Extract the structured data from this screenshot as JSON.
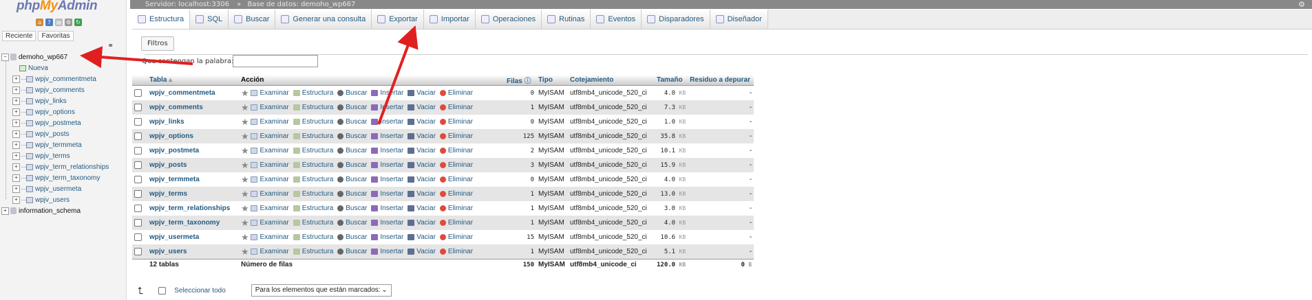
{
  "app": {
    "logo_php": "php",
    "logo_my": "My",
    "logo_admin": "Admin",
    "nav_tab_recent": "Reciente",
    "nav_tab_favorites": "Favoritas"
  },
  "breadcrumb": {
    "server": "Servidor: localhost:3306",
    "database": "Base de datos: demoho_wp667"
  },
  "tree": {
    "db_name": "demoho_wp667",
    "new_label": "Nueva",
    "tables": [
      "wpjv_commentmeta",
      "wpjv_comments",
      "wpjv_links",
      "wpjv_options",
      "wpjv_postmeta",
      "wpjv_posts",
      "wpjv_termmeta",
      "wpjv_terms",
      "wpjv_term_relationships",
      "wpjv_term_taxonomy",
      "wpjv_usermeta",
      "wpjv_users"
    ],
    "other_db": "information_schema"
  },
  "tabs": [
    {
      "label": "Estructura",
      "icon": "structure-icon"
    },
    {
      "label": "SQL",
      "icon": "sql-icon"
    },
    {
      "label": "Buscar",
      "icon": "search-icon"
    },
    {
      "label": "Generar una consulta",
      "icon": "query-icon"
    },
    {
      "label": "Exportar",
      "icon": "export-icon"
    },
    {
      "label": "Importar",
      "icon": "import-icon"
    },
    {
      "label": "Operaciones",
      "icon": "wrench-icon"
    },
    {
      "label": "Rutinas",
      "icon": "routines-icon"
    },
    {
      "label": "Eventos",
      "icon": "clock-icon"
    },
    {
      "label": "Disparadores",
      "icon": "triggers-icon"
    },
    {
      "label": "Diseñador",
      "icon": "designer-icon"
    }
  ],
  "filter": {
    "legend": "Filtros",
    "label": "Que contengan la palabra:",
    "value": ""
  },
  "table": {
    "headers": {
      "table": "Tabla",
      "action": "Acción",
      "rows": "Filas",
      "type": "Tipo",
      "collation": "Cotejamiento",
      "size": "Tamaño",
      "overhead": "Residuo a depurar"
    },
    "actions": {
      "browse": "Examinar",
      "structure": "Estructura",
      "search": "Buscar",
      "insert": "Insertar",
      "empty": "Vaciar",
      "drop": "Eliminar"
    },
    "rows": [
      {
        "name": "wpjv_commentmeta",
        "rows": "0",
        "type": "MyISAM",
        "collation": "utf8mb4_unicode_520_ci",
        "size": "4.0",
        "unit": "KB",
        "overhead": "-"
      },
      {
        "name": "wpjv_comments",
        "rows": "1",
        "type": "MyISAM",
        "collation": "utf8mb4_unicode_520_ci",
        "size": "7.3",
        "unit": "KB",
        "overhead": "-"
      },
      {
        "name": "wpjv_links",
        "rows": "0",
        "type": "MyISAM",
        "collation": "utf8mb4_unicode_520_ci",
        "size": "1.0",
        "unit": "KB",
        "overhead": "-"
      },
      {
        "name": "wpjv_options",
        "rows": "125",
        "type": "MyISAM",
        "collation": "utf8mb4_unicode_520_ci",
        "size": "35.8",
        "unit": "KB",
        "overhead": "-"
      },
      {
        "name": "wpjv_postmeta",
        "rows": "2",
        "type": "MyISAM",
        "collation": "utf8mb4_unicode_520_ci",
        "size": "10.1",
        "unit": "KB",
        "overhead": "-"
      },
      {
        "name": "wpjv_posts",
        "rows": "3",
        "type": "MyISAM",
        "collation": "utf8mb4_unicode_520_ci",
        "size": "15.9",
        "unit": "KB",
        "overhead": "-"
      },
      {
        "name": "wpjv_termmeta",
        "rows": "0",
        "type": "MyISAM",
        "collation": "utf8mb4_unicode_520_ci",
        "size": "4.0",
        "unit": "KB",
        "overhead": "-"
      },
      {
        "name": "wpjv_terms",
        "rows": "1",
        "type": "MyISAM",
        "collation": "utf8mb4_unicode_520_ci",
        "size": "13.0",
        "unit": "KB",
        "overhead": "-"
      },
      {
        "name": "wpjv_term_relationships",
        "rows": "1",
        "type": "MyISAM",
        "collation": "utf8mb4_unicode_520_ci",
        "size": "3.0",
        "unit": "KB",
        "overhead": "-"
      },
      {
        "name": "wpjv_term_taxonomy",
        "rows": "1",
        "type": "MyISAM",
        "collation": "utf8mb4_unicode_520_ci",
        "size": "4.0",
        "unit": "KB",
        "overhead": "-"
      },
      {
        "name": "wpjv_usermeta",
        "rows": "15",
        "type": "MyISAM",
        "collation": "utf8mb4_unicode_520_ci",
        "size": "10.6",
        "unit": "KB",
        "overhead": "-"
      },
      {
        "name": "wpjv_users",
        "rows": "1",
        "type": "MyISAM",
        "collation": "utf8mb4_unicode_520_ci",
        "size": "5.1",
        "unit": "KB",
        "overhead": "-"
      }
    ],
    "footer": {
      "count": "12 tablas",
      "label": "Número de filas",
      "rows": "150",
      "type": "MyISAM",
      "collation": "utf8mb4_unicode_ci",
      "size": "120.0",
      "unit": "KB",
      "overhead": "0",
      "overhead_unit": "B"
    }
  },
  "bottom": {
    "select_all": "Seleccionar todo",
    "bulk_placeholder": "Para los elementos que están marcados:"
  },
  "colors": {
    "annotation_arrow": "#e02020",
    "link": "#235a81"
  }
}
